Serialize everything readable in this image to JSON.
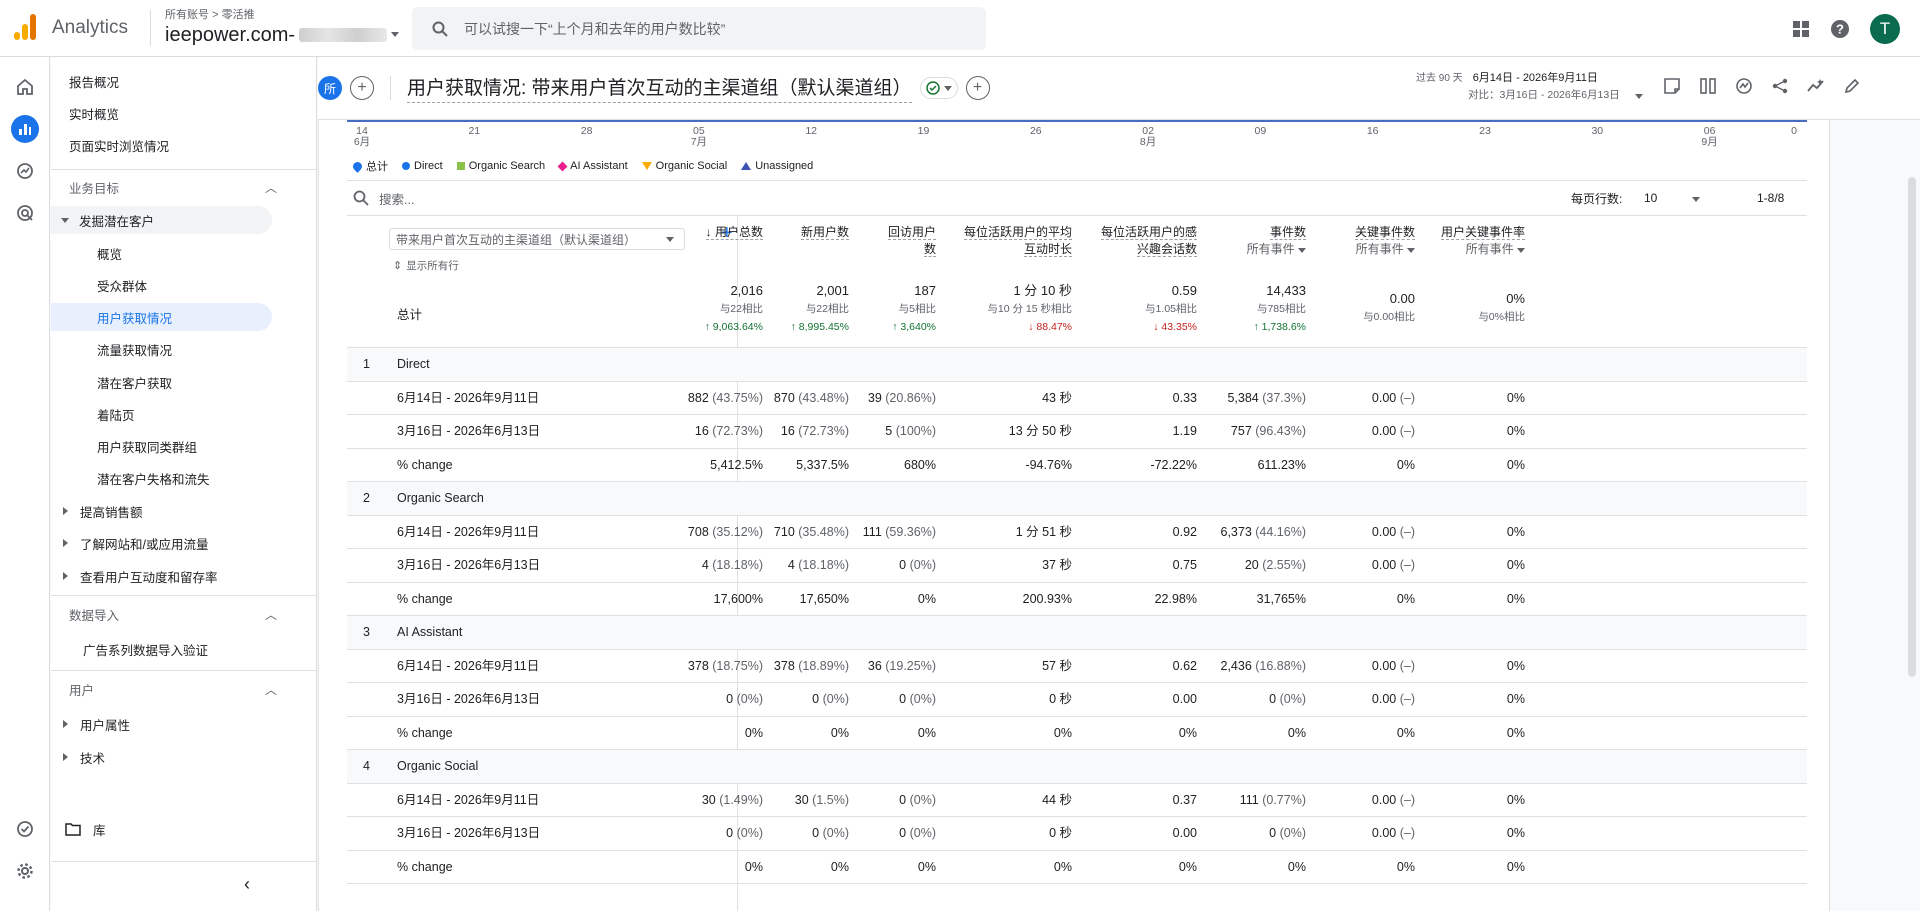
{
  "app": {
    "brand": "Analytics",
    "crumbs": "所有账号 > 零活推",
    "property": "ieepower.com-",
    "search_placeholder": "可以试搜一下“上个月和去年的用户数比较”",
    "avatar": "T"
  },
  "nav": {
    "top_items": [
      "报告概况",
      "实时概览",
      "页面实时浏览情况"
    ],
    "section1": "业务目标",
    "group1": "发掘潜在客户",
    "group1_items": [
      "概览",
      "受众群体",
      "用户获取情况",
      "流量获取情况",
      "潜在客户获取",
      "着陆页",
      "用户获取同类群组",
      "潜在客户失格和流失"
    ],
    "collapsed": [
      "提高销售额",
      "了解网站和/或应用流量",
      "查看用户互动度和留存率"
    ],
    "section2": "数据导入",
    "section2_item": "广告系列数据导入验证",
    "section3": "用户",
    "section3_items": [
      "用户属性",
      "技术"
    ],
    "library": "库"
  },
  "header": {
    "chip": "所",
    "title": "用户获取情况: 带来用户首次互动的主渠道组（默认渠道组）",
    "period_label": "过去 90 天",
    "period": "6月14日 - 2026年9月11日",
    "compare": "对比：3月16日 - 2026年6月13日"
  },
  "axis_ticks": [
    {
      "d": "14",
      "m": "6月"
    },
    {
      "d": "21",
      "m": ""
    },
    {
      "d": "28",
      "m": ""
    },
    {
      "d": "05",
      "m": "7月"
    },
    {
      "d": "12",
      "m": ""
    },
    {
      "d": "19",
      "m": ""
    },
    {
      "d": "26",
      "m": ""
    },
    {
      "d": "02",
      "m": "8月"
    },
    {
      "d": "09",
      "m": ""
    },
    {
      "d": "16",
      "m": ""
    },
    {
      "d": "23",
      "m": ""
    },
    {
      "d": "30",
      "m": ""
    },
    {
      "d": "06",
      "m": "9月"
    },
    {
      "d": "0",
      "m": ""
    }
  ],
  "legend": [
    {
      "name": "总计",
      "color": "#1a73e8",
      "shape": "drop"
    },
    {
      "name": "Direct",
      "color": "#1a73e8",
      "shape": "circle"
    },
    {
      "name": "Organic Search",
      "color": "#8bc34a",
      "shape": "square"
    },
    {
      "name": "AI Assistant",
      "color": "#e91e8c",
      "shape": "diamond"
    },
    {
      "name": "Organic Social",
      "color": "#f9ab00",
      "shape": "tri-down"
    },
    {
      "name": "Unassigned",
      "color": "#3f51b5",
      "shape": "tri-up"
    }
  ],
  "toolbar": {
    "search_placeholder": "搜索...",
    "rows_label": "每页行数:",
    "rows_value": "10",
    "range": "1-8/8"
  },
  "table": {
    "dimension": "带来用户首次互动的主渠道组（默认渠道组）",
    "show_all": "显示所有行",
    "total_label": "总计",
    "columns": [
      {
        "l1": "↓ 用户总数",
        "l2": "",
        "sub": ""
      },
      {
        "l1": "新用户数",
        "l2": "",
        "sub": ""
      },
      {
        "l1": "回访用户",
        "l2": "数",
        "sub": ""
      },
      {
        "l1": "每位活跃用户的平均",
        "l2": "互动时长",
        "sub": ""
      },
      {
        "l1": "每位活跃用户的感",
        "l2": "兴趣会话数",
        "sub": ""
      },
      {
        "l1": "事件数",
        "l2": "",
        "sub": "所有事件"
      },
      {
        "l1": "关键事件数",
        "l2": "",
        "sub": "所有事件"
      },
      {
        "l1": "用户关键事件率",
        "l2": "",
        "sub": "所有事件"
      }
    ],
    "totals": [
      {
        "v": "2,016",
        "c": "与22相比",
        "d": "↑ 9,063.64%",
        "up": true
      },
      {
        "v": "2,001",
        "c": "与22相比",
        "d": "↑ 8,995.45%",
        "up": true
      },
      {
        "v": "187",
        "c": "与5相比",
        "d": "↑ 3,640%",
        "up": true
      },
      {
        "v": "1 分 10 秒",
        "c": "与10 分 15 秒相比",
        "d": "↓ 88.47%",
        "up": false
      },
      {
        "v": "0.59",
        "c": "与1.05相比",
        "d": "↓ 43.35%",
        "up": false
      },
      {
        "v": "14,433",
        "c": "与785相比",
        "d": "↑ 1,738.6%",
        "up": true
      },
      {
        "v": "0.00",
        "c": "与0.00相比",
        "d": "",
        "up": true
      },
      {
        "v": "0%",
        "c": "与0%相比",
        "d": "",
        "up": true
      }
    ],
    "groups": [
      {
        "num": "1",
        "name": "Direct",
        "rows": [
          {
            "label": "6月14日 - 2026年9月11日",
            "cells": [
              [
                "882",
                "(43.75%)"
              ],
              [
                "870",
                "(43.48%)"
              ],
              [
                "39",
                "(20.86%)"
              ],
              [
                "43 秒",
                ""
              ],
              [
                "0.33",
                ""
              ],
              [
                "5,384",
                "(37.3%)"
              ],
              [
                "0.00",
                "(–)"
              ],
              [
                "0%",
                ""
              ]
            ]
          },
          {
            "label": "3月16日 - 2026年6月13日",
            "cells": [
              [
                "16",
                "(72.73%)"
              ],
              [
                "16",
                "(72.73%)"
              ],
              [
                "5",
                "(100%)"
              ],
              [
                "13 分 50 秒",
                ""
              ],
              [
                "1.19",
                ""
              ],
              [
                "757",
                "(96.43%)"
              ],
              [
                "0.00",
                "(–)"
              ],
              [
                "0%",
                ""
              ]
            ]
          },
          {
            "label": "% change",
            "cells": [
              [
                "5,412.5%",
                ""
              ],
              [
                "5,337.5%",
                ""
              ],
              [
                "680%",
                ""
              ],
              [
                "-94.76%",
                ""
              ],
              [
                "-72.22%",
                ""
              ],
              [
                "611.23%",
                ""
              ],
              [
                "0%",
                ""
              ],
              [
                "0%",
                ""
              ]
            ]
          }
        ]
      },
      {
        "num": "2",
        "name": "Organic Search",
        "rows": [
          {
            "label": "6月14日 - 2026年9月11日",
            "cells": [
              [
                "708",
                "(35.12%)"
              ],
              [
                "710",
                "(35.48%)"
              ],
              [
                "111",
                "(59.36%)"
              ],
              [
                "1 分 51 秒",
                ""
              ],
              [
                "0.92",
                ""
              ],
              [
                "6,373",
                "(44.16%)"
              ],
              [
                "0.00",
                "(–)"
              ],
              [
                "0%",
                ""
              ]
            ]
          },
          {
            "label": "3月16日 - 2026年6月13日",
            "cells": [
              [
                "4",
                "(18.18%)"
              ],
              [
                "4",
                "(18.18%)"
              ],
              [
                "0",
                "(0%)"
              ],
              [
                "37 秒",
                ""
              ],
              [
                "0.75",
                ""
              ],
              [
                "20",
                "(2.55%)"
              ],
              [
                "0.00",
                "(–)"
              ],
              [
                "0%",
                ""
              ]
            ]
          },
          {
            "label": "% change",
            "cells": [
              [
                "17,600%",
                ""
              ],
              [
                "17,650%",
                ""
              ],
              [
                "0%",
                ""
              ],
              [
                "200.93%",
                ""
              ],
              [
                "22.98%",
                ""
              ],
              [
                "31,765%",
                ""
              ],
              [
                "0%",
                ""
              ],
              [
                "0%",
                ""
              ]
            ]
          }
        ]
      },
      {
        "num": "3",
        "name": "AI Assistant",
        "rows": [
          {
            "label": "6月14日 - 2026年9月11日",
            "cells": [
              [
                "378",
                "(18.75%)"
              ],
              [
                "378",
                "(18.89%)"
              ],
              [
                "36",
                "(19.25%)"
              ],
              [
                "57 秒",
                ""
              ],
              [
                "0.62",
                ""
              ],
              [
                "2,436",
                "(16.88%)"
              ],
              [
                "0.00",
                "(–)"
              ],
              [
                "0%",
                ""
              ]
            ]
          },
          {
            "label": "3月16日 - 2026年6月13日",
            "cells": [
              [
                "0",
                "(0%)"
              ],
              [
                "0",
                "(0%)"
              ],
              [
                "0",
                "(0%)"
              ],
              [
                "0 秒",
                ""
              ],
              [
                "0.00",
                ""
              ],
              [
                "0",
                "(0%)"
              ],
              [
                "0.00",
                "(–)"
              ],
              [
                "0%",
                ""
              ]
            ]
          },
          {
            "label": "% change",
            "cells": [
              [
                "0%",
                ""
              ],
              [
                "0%",
                ""
              ],
              [
                "0%",
                ""
              ],
              [
                "0%",
                ""
              ],
              [
                "0%",
                ""
              ],
              [
                "0%",
                ""
              ],
              [
                "0%",
                ""
              ],
              [
                "0%",
                ""
              ]
            ]
          }
        ]
      },
      {
        "num": "4",
        "name": "Organic Social",
        "rows": [
          {
            "label": "6月14日 - 2026年9月11日",
            "cells": [
              [
                "30",
                "(1.49%)"
              ],
              [
                "30",
                "(1.5%)"
              ],
              [
                "0",
                "(0%)"
              ],
              [
                "44 秒",
                ""
              ],
              [
                "0.37",
                ""
              ],
              [
                "111",
                "(0.77%)"
              ],
              [
                "0.00",
                "(–)"
              ],
              [
                "0%",
                ""
              ]
            ]
          },
          {
            "label": "3月16日 - 2026年6月13日",
            "cells": [
              [
                "0",
                "(0%)"
              ],
              [
                "0",
                "(0%)"
              ],
              [
                "0",
                "(0%)"
              ],
              [
                "0 秒",
                ""
              ],
              [
                "0.00",
                ""
              ],
              [
                "0",
                "(0%)"
              ],
              [
                "0.00",
                "(–)"
              ],
              [
                "0%",
                ""
              ]
            ]
          },
          {
            "label": "% change",
            "cells": [
              [
                "0%",
                ""
              ],
              [
                "0%",
                ""
              ],
              [
                "0%",
                ""
              ],
              [
                "0%",
                ""
              ],
              [
                "0%",
                ""
              ],
              [
                "0%",
                ""
              ],
              [
                "0%",
                ""
              ],
              [
                "0%",
                ""
              ]
            ]
          }
        ]
      }
    ]
  },
  "colors": {
    "accent": "#1a73e8",
    "up": "#137333",
    "down": "#c5221f",
    "active_nav_bg": "#e8f0fe"
  }
}
